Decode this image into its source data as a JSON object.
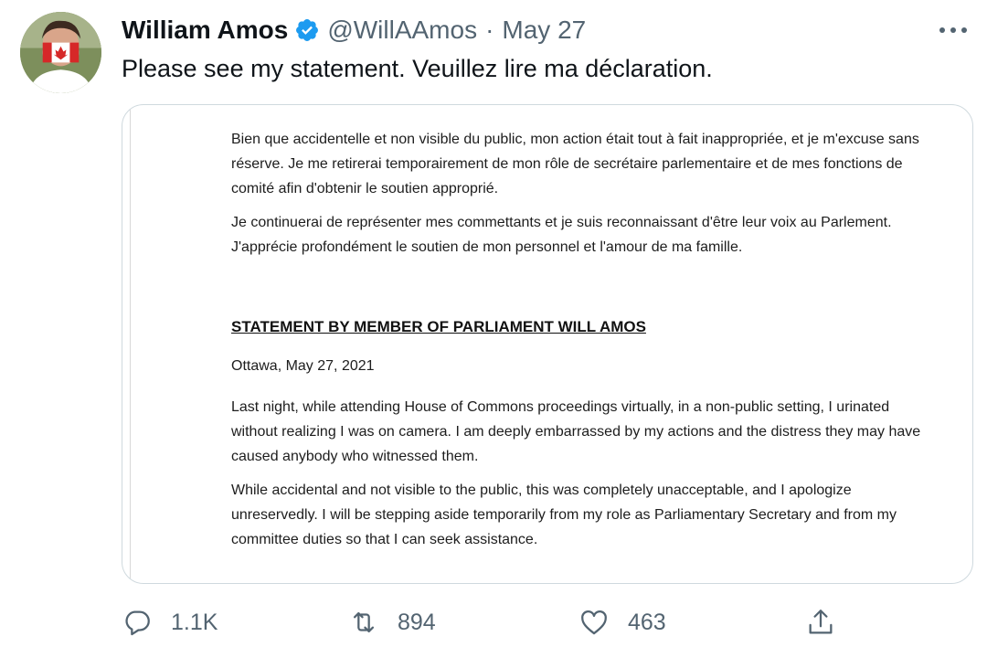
{
  "tweet": {
    "author": {
      "name": "William Amos",
      "handle": "@WillAAmos",
      "verified": true,
      "avatar_icon": "avatar-canada-mask"
    },
    "separator": "·",
    "date": "May 27",
    "text": "Please see my statement. Veuillez lire ma déclaration.",
    "more_icon": "more-dots-icon"
  },
  "media": {
    "paragraphs_fr": [
      "Bien que accidentelle et non visible du public, mon action était tout à fait inappropriée, et je m'excuse sans réserve. Je me retirerai temporairement de mon rôle de secrétaire parlementaire et de mes fonctions de comité afin d'obtenir le soutien approprié.",
      "Je continuerai de représenter mes commettants et je suis reconnaissant d'être leur voix au Parlement. J'apprécie profondément le soutien de mon personnel et l'amour de ma famille."
    ],
    "heading": "STATEMENT BY MEMBER OF PARLIAMENT WILL AMOS",
    "dateline": "Ottawa, May 27, 2021",
    "paragraphs_en": [
      "Last night, while attending House of Commons proceedings virtually, in a non-public setting, I urinated without realizing I was on camera. I am deeply embarrassed by my actions and the distress they may have caused anybody who witnessed them.",
      "While accidental and not visible to the public, this was completely unacceptable, and I apologize unreservedly. I will be stepping aside temporarily from my role as Parliamentary Secretary and from my committee duties so that I can seek assistance."
    ]
  },
  "actions": {
    "reply": {
      "icon": "reply-icon",
      "count": "1.1K"
    },
    "retweet": {
      "icon": "retweet-icon",
      "count": "894"
    },
    "like": {
      "icon": "heart-icon",
      "count": "463"
    },
    "share": {
      "icon": "share-icon"
    }
  },
  "colors": {
    "text_primary": "#0f1419",
    "text_secondary": "#536471",
    "verified_blue": "#1d9bf0",
    "border": "#cfd9de"
  }
}
